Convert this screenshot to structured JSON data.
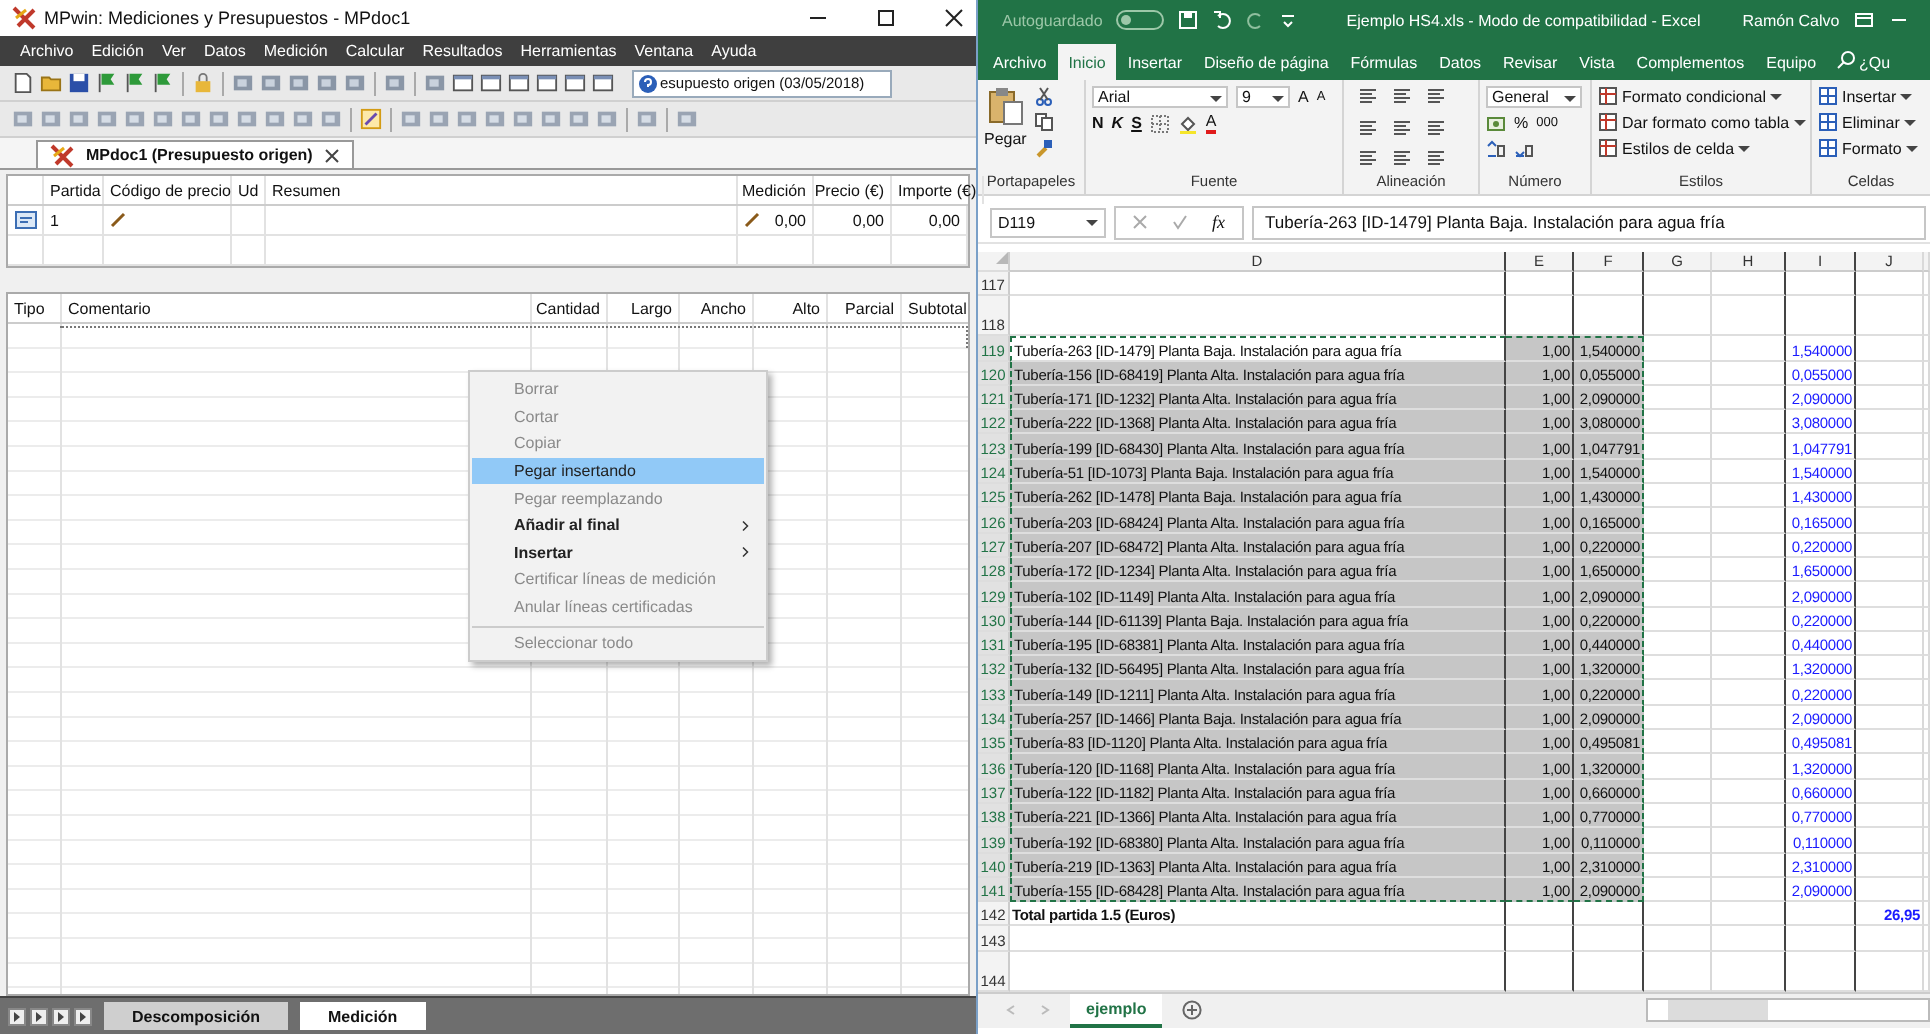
{
  "mpwin": {
    "window": {
      "title": "MPwin: Mediciones y Presupuestos - MPdoc1"
    },
    "menu": [
      "Archivo",
      "Edición",
      "Ver",
      "Datos",
      "Medición",
      "Calcular",
      "Resultados",
      "Herramientas",
      "Ventana",
      "Ayuda"
    ],
    "toolbar_field": {
      "value": "esupuesto origen (03/05/2018)"
    },
    "document_tab": {
      "label": "MPdoc1 (Presupuesto origen)"
    },
    "budget_table": {
      "columns": [
        "Partida",
        "Código de precio",
        "Ud",
        "Resumen",
        "Medición",
        "Precio (€)",
        "Importe (€)"
      ],
      "rows": [
        {
          "partida": "1",
          "medicion": "0,00",
          "precio": "0,00",
          "importe": "0,00"
        }
      ]
    },
    "measurement_table": {
      "columns": [
        "Tipo",
        "Comentario",
        "Cantidad",
        "Largo",
        "Ancho",
        "Alto",
        "Parcial",
        "Subtotal"
      ]
    },
    "context_menu": [
      {
        "label": "Borrar",
        "disabled": true,
        "selected": false,
        "submenu": false,
        "separator_before": false
      },
      {
        "label": "Cortar",
        "disabled": true,
        "selected": false,
        "submenu": false,
        "separator_before": false
      },
      {
        "label": "Copiar",
        "disabled": true,
        "selected": false,
        "submenu": false,
        "separator_before": false
      },
      {
        "label": "Pegar insertando",
        "disabled": false,
        "selected": true,
        "submenu": false,
        "separator_before": false
      },
      {
        "label": "Pegar reemplazando",
        "disabled": true,
        "selected": false,
        "submenu": false,
        "separator_before": false
      },
      {
        "label": "Añadir al final",
        "disabled": false,
        "selected": false,
        "submenu": true,
        "separator_before": false
      },
      {
        "label": "Insertar",
        "disabled": false,
        "selected": false,
        "submenu": true,
        "separator_before": false
      },
      {
        "label": "Certificar líneas de medición",
        "disabled": true,
        "selected": false,
        "submenu": false,
        "separator_before": false
      },
      {
        "label": "Anular líneas certificadas",
        "disabled": true,
        "selected": false,
        "submenu": false,
        "separator_before": false
      },
      {
        "label": "Seleccionar todo",
        "disabled": true,
        "selected": false,
        "submenu": false,
        "separator_before": true
      }
    ],
    "sheet_tabs": [
      {
        "label": "Descomposición",
        "selected": false
      },
      {
        "label": "Medición",
        "selected": true
      }
    ]
  },
  "excel": {
    "window": {
      "autosave": "Autoguardado",
      "title": "Ejemplo HS4.xls  -  Modo de compatibilidad  -  Excel",
      "user": "Ramón Calvo"
    },
    "tabs": [
      {
        "label": "Archivo",
        "selected": false
      },
      {
        "label": "Inicio",
        "selected": true
      },
      {
        "label": "Insertar",
        "selected": false
      },
      {
        "label": "Diseño de página",
        "selected": false
      },
      {
        "label": "Fórmulas",
        "selected": false
      },
      {
        "label": "Datos",
        "selected": false
      },
      {
        "label": "Revisar",
        "selected": false
      },
      {
        "label": "Vista",
        "selected": false
      },
      {
        "label": "Complementos",
        "selected": false
      },
      {
        "label": "Equipo",
        "selected": false
      }
    ],
    "search": "¿Qu",
    "ribbon": {
      "clipboard": {
        "paste": "Pegar",
        "label": "Portapapeles"
      },
      "font": {
        "name": "Arial",
        "size": "9",
        "grow": "A",
        "shrink": "A",
        "bold": "N",
        "italic": "K",
        "underline": "S",
        "font_color_label": "A",
        "label": "Fuente"
      },
      "alignment": {
        "label": "Alineación"
      },
      "number": {
        "format": "General",
        "percent": "%",
        "thousands": "000",
        "label": "Número"
      },
      "styles": {
        "items": [
          "Formato condicional",
          "Dar formato como tabla",
          "Estilos de celda"
        ],
        "label": "Estilos"
      },
      "cells": {
        "items": [
          "Insertar",
          "Eliminar",
          "Formato"
        ],
        "label": "Celdas"
      }
    },
    "name_box": "D119",
    "function_label": "fx",
    "formula": "Tubería-263 [ID-1479] Planta Baja. Instalación para agua fría",
    "columns": [
      "D",
      "E",
      "F",
      "G",
      "H",
      "I",
      "J"
    ],
    "rows": [
      {
        "number": "117",
        "kind": "blank",
        "tall": false
      },
      {
        "number": "118",
        "kind": "blank",
        "tall": true
      },
      {
        "number": "119",
        "kind": "item",
        "tall": false,
        "selected": true,
        "active": true,
        "d": "Tubería-263 [ID-1479] Planta Baja. Instalación para agua fría",
        "e": "1,00",
        "f": "1,540000",
        "i": "1,540000"
      },
      {
        "number": "120",
        "kind": "item",
        "tall": false,
        "selected": true,
        "active": false,
        "d": "Tubería-156 [ID-68419] Planta Alta. Instalación para agua fría",
        "e": "1,00",
        "f": "0,055000",
        "i": "0,055000"
      },
      {
        "number": "121",
        "kind": "item",
        "tall": false,
        "selected": true,
        "active": false,
        "d": "Tubería-171 [ID-1232] Planta Alta. Instalación para agua fría",
        "e": "1,00",
        "f": "2,090000",
        "i": "2,090000"
      },
      {
        "number": "122",
        "kind": "item",
        "tall": false,
        "selected": true,
        "active": false,
        "d": "Tubería-222 [ID-1368] Planta Alta. Instalación para agua fría",
        "e": "1,00",
        "f": "3,080000",
        "i": "3,080000"
      },
      {
        "number": "123",
        "kind": "item",
        "tall": false,
        "selected": true,
        "active": false,
        "d": "Tubería-199 [ID-68430] Planta Alta. Instalación para agua fría",
        "e": "1,00",
        "f": "1,047791",
        "i": "1,047791"
      },
      {
        "number": "124",
        "kind": "item",
        "tall": false,
        "selected": true,
        "active": false,
        "d": "Tubería-51 [ID-1073] Planta Baja. Instalación para agua fría",
        "e": "1,00",
        "f": "1,540000",
        "i": "1,540000"
      },
      {
        "number": "125",
        "kind": "item",
        "tall": false,
        "selected": true,
        "active": false,
        "d": "Tubería-262 [ID-1478] Planta Baja. Instalación para agua fría",
        "e": "1,00",
        "f": "1,430000",
        "i": "1,430000"
      },
      {
        "number": "126",
        "kind": "item",
        "tall": false,
        "selected": true,
        "active": false,
        "d": "Tubería-203 [ID-68424] Planta Alta. Instalación para agua fría",
        "e": "1,00",
        "f": "0,165000",
        "i": "0,165000"
      },
      {
        "number": "127",
        "kind": "item",
        "tall": false,
        "selected": true,
        "active": false,
        "d": "Tubería-207 [ID-68472] Planta Alta. Instalación para agua fría",
        "e": "1,00",
        "f": "0,220000",
        "i": "0,220000"
      },
      {
        "number": "128",
        "kind": "item",
        "tall": false,
        "selected": true,
        "active": false,
        "d": "Tubería-172 [ID-1234] Planta Alta. Instalación para agua fría",
        "e": "1,00",
        "f": "1,650000",
        "i": "1,650000"
      },
      {
        "number": "129",
        "kind": "item",
        "tall": false,
        "selected": true,
        "active": false,
        "d": "Tubería-102 [ID-1149] Planta Alta. Instalación para agua fría",
        "e": "1,00",
        "f": "2,090000",
        "i": "2,090000"
      },
      {
        "number": "130",
        "kind": "item",
        "tall": false,
        "selected": true,
        "active": false,
        "d": "Tubería-144 [ID-61139] Planta Baja. Instalación para agua fría",
        "e": "1,00",
        "f": "0,220000",
        "i": "0,220000"
      },
      {
        "number": "131",
        "kind": "item",
        "tall": false,
        "selected": true,
        "active": false,
        "d": "Tubería-195 [ID-68381] Planta Alta. Instalación para agua fría",
        "e": "1,00",
        "f": "0,440000",
        "i": "0,440000"
      },
      {
        "number": "132",
        "kind": "item",
        "tall": false,
        "selected": true,
        "active": false,
        "d": "Tubería-132 [ID-56495] Planta Alta. Instalación para agua fría",
        "e": "1,00",
        "f": "1,320000",
        "i": "1,320000"
      },
      {
        "number": "133",
        "kind": "item",
        "tall": false,
        "selected": true,
        "active": false,
        "d": "Tubería-149 [ID-1211] Planta Alta. Instalación para agua fría",
        "e": "1,00",
        "f": "0,220000",
        "i": "0,220000"
      },
      {
        "number": "134",
        "kind": "item",
        "tall": false,
        "selected": true,
        "active": false,
        "d": "Tubería-257 [ID-1466] Planta Baja. Instalación para agua fría",
        "e": "1,00",
        "f": "2,090000",
        "i": "2,090000"
      },
      {
        "number": "135",
        "kind": "item",
        "tall": false,
        "selected": true,
        "active": false,
        "d": "Tubería-83 [ID-1120] Planta Alta. Instalación para agua fría",
        "e": "1,00",
        "f": "0,495081",
        "i": "0,495081"
      },
      {
        "number": "136",
        "kind": "item",
        "tall": false,
        "selected": true,
        "active": false,
        "d": "Tubería-120 [ID-1168] Planta Alta. Instalación para agua fría",
        "e": "1,00",
        "f": "1,320000",
        "i": "1,320000"
      },
      {
        "number": "137",
        "kind": "item",
        "tall": false,
        "selected": true,
        "active": false,
        "d": "Tubería-122 [ID-1182] Planta Alta. Instalación para agua fría",
        "e": "1,00",
        "f": "0,660000",
        "i": "0,660000"
      },
      {
        "number": "138",
        "kind": "item",
        "tall": false,
        "selected": true,
        "active": false,
        "d": "Tubería-221 [ID-1366] Planta Alta. Instalación para agua fría",
        "e": "1,00",
        "f": "0,770000",
        "i": "0,770000"
      },
      {
        "number": "139",
        "kind": "item",
        "tall": false,
        "selected": true,
        "active": false,
        "d": "Tubería-192 [ID-68380] Planta Alta. Instalación para agua fría",
        "e": "1,00",
        "f": "0,110000",
        "i": "0,110000"
      },
      {
        "number": "140",
        "kind": "item",
        "tall": false,
        "selected": true,
        "active": false,
        "d": "Tubería-219 [ID-1363] Planta Alta. Instalación para agua fría",
        "e": "1,00",
        "f": "2,310000",
        "i": "2,310000"
      },
      {
        "number": "141",
        "kind": "item",
        "tall": false,
        "selected": true,
        "active": false,
        "d": "Tubería-155 [ID-68428] Planta Alta. Instalación para agua fría",
        "e": "1,00",
        "f": "2,090000",
        "i": "2,090000"
      },
      {
        "number": "142",
        "kind": "total",
        "tall": false,
        "d": "Total partida 1.5 (Euros)",
        "j": "26,95"
      },
      {
        "number": "143",
        "kind": "blank",
        "tall": false
      },
      {
        "number": "144",
        "kind": "blank",
        "tall": true
      }
    ],
    "sheet_tabs": [
      {
        "label": "ejemplo",
        "selected": true
      }
    ]
  }
}
